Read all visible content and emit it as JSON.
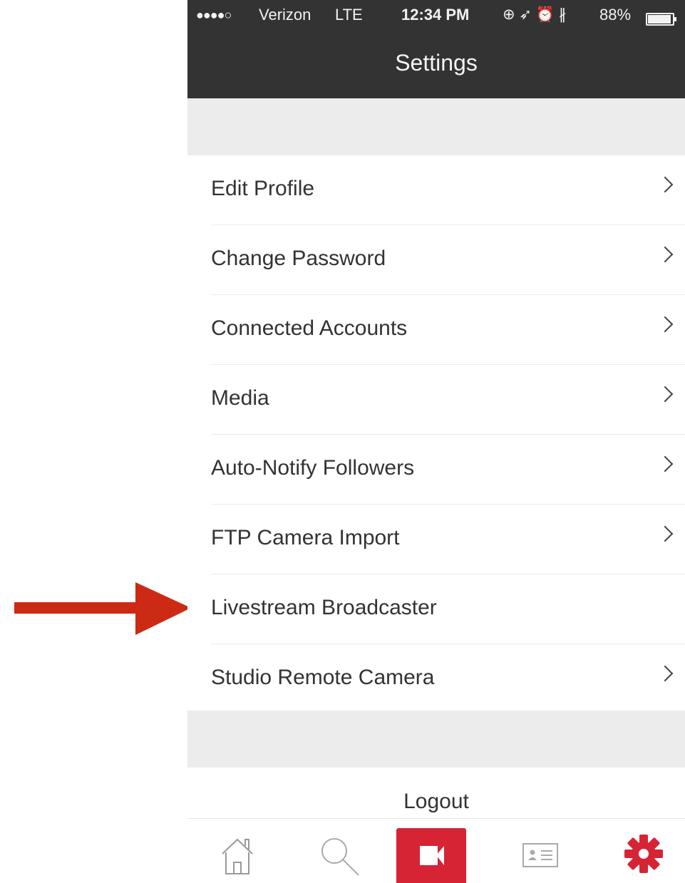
{
  "status_bar": {
    "signal": "●●●●○",
    "carrier": "Verizon",
    "network": "LTE",
    "time": "12:34 PM",
    "icons": "⊕ ➶ ⏰ ∦",
    "battery": "88%"
  },
  "nav": {
    "title": "Settings"
  },
  "menu": {
    "items": [
      {
        "label": "Edit Profile"
      },
      {
        "label": "Change Password"
      },
      {
        "label": "Connected Accounts"
      },
      {
        "label": "Media"
      },
      {
        "label": "Auto-Notify Followers"
      },
      {
        "label": "FTP Camera Import"
      },
      {
        "label": "Livestream Broadcaster"
      },
      {
        "label": "Studio Remote Camera"
      }
    ]
  },
  "logout": {
    "label": "Logout"
  },
  "tabbar": {
    "tabs": [
      {
        "icon": "home-icon"
      },
      {
        "icon": "search-icon"
      },
      {
        "icon": "video-camera-icon"
      },
      {
        "icon": "profile-card-icon"
      },
      {
        "icon": "gear-icon"
      }
    ]
  },
  "colors": {
    "nav_bg": "#333333",
    "accent_red": "#d62434",
    "annotation_arrow": "#cc2a14",
    "section_gap": "#ececec"
  },
  "annotation": {
    "icon": "arrow-right-icon"
  }
}
